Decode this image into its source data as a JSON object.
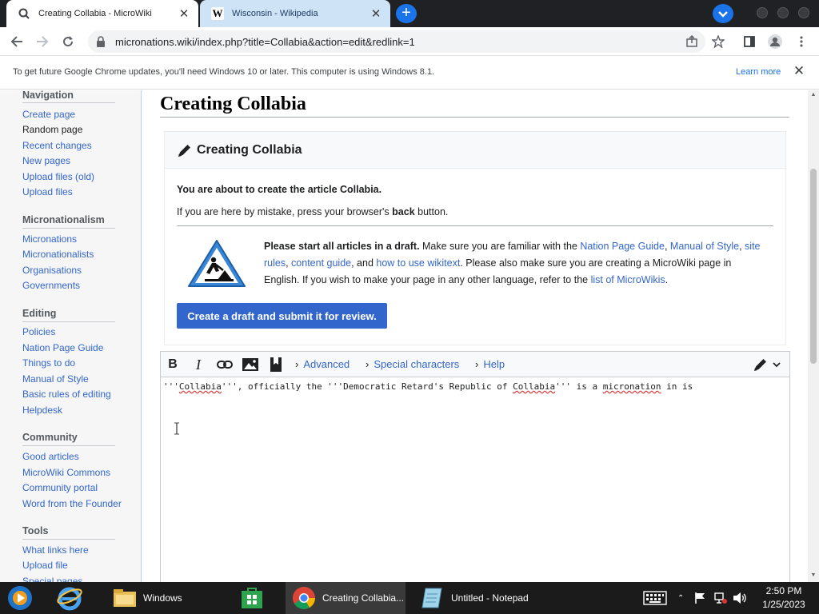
{
  "browser": {
    "tabs": [
      {
        "title": "Creating Collabia - MicroWiki",
        "active": true
      },
      {
        "title": "Wisconsin - Wikipedia",
        "active": false
      }
    ],
    "url": "micronations.wiki/index.php?title=Collabia&action=edit&redlink=1",
    "infobar_message": "To get future Google Chrome updates, you'll need Windows 10 or later. This computer is using Windows 8.1.",
    "infobar_link": "Learn more"
  },
  "sidebar": {
    "sections": [
      {
        "heading": "Navigation",
        "items": [
          "Create page",
          "Random page",
          "Recent changes",
          "New pages",
          "Upload files (old)",
          "Upload files"
        ]
      },
      {
        "heading": "Micronationalism",
        "items": [
          "Micronations",
          "Micronationalists",
          "Organisations",
          "Governments"
        ]
      },
      {
        "heading": "Editing",
        "items": [
          "Policies",
          "Nation Page Guide",
          "Things to do",
          "Manual of Style",
          "Basic rules of editing",
          "Helpdesk"
        ]
      },
      {
        "heading": "Community",
        "items": [
          "Good articles",
          "MicroWiki Commons",
          "Community portal",
          "Word from the Founder"
        ]
      },
      {
        "heading": "Tools",
        "items": [
          "What links here",
          "Upload file",
          "Special pages"
        ]
      }
    ]
  },
  "content": {
    "page_title": "Creating Collabia",
    "notice": {
      "title": "Creating Collabia",
      "line1": "You are about to create the article Collabia.",
      "line2_prefix": "If you are here by mistake, press your browser's ",
      "line2_bold": "back",
      "line2_suffix": " button.",
      "para": {
        "bold": "Please start all articles in a draft.",
        "t1": " Make sure you are familiar with the ",
        "l1": "Nation Page Guide",
        "t2": ", ",
        "l2": "Manual of Style",
        "t3": ", ",
        "l3": "site rules",
        "t4": ", ",
        "l4": "content guide",
        "t5": ", and ",
        "l5": "how to use wikitext",
        "t6": ". Please also make sure you are creating a MicroWiki page in English. If you wish to make your page in any other language, refer to the ",
        "l6": "list of MicroWikis",
        "t7": "."
      },
      "button": "Create a draft and submit it for review."
    },
    "editor": {
      "toolbar": {
        "bold": "B",
        "italic": "I",
        "advanced": "Advanced",
        "special": "Special characters",
        "help": "Help"
      },
      "text": {
        "a": "'''",
        "b": "Collabia",
        "c": "''', officially the '''Democratic Retard's Republic of ",
        "d": "Collabia",
        "e": "''' is a ",
        "f": "micronation",
        "g": " in is"
      }
    }
  },
  "taskbar": {
    "items": [
      "Windows",
      "Creating Collabia...",
      "Untitled - Notepad"
    ],
    "time": "2:50 PM",
    "date": "1/25/2023"
  }
}
